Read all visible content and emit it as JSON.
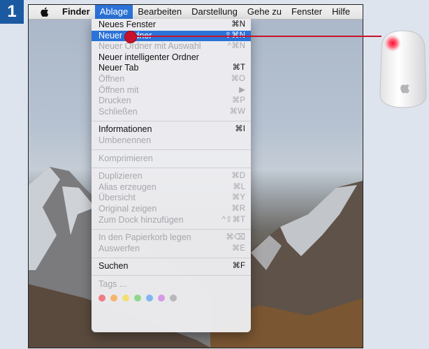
{
  "step_number": "1",
  "menubar": {
    "app_name": "Finder",
    "menus": [
      "Ablage",
      "Bearbeiten",
      "Darstellung",
      "Gehe zu",
      "Fenster",
      "Hilfe"
    ],
    "active_menu": "Ablage"
  },
  "file_menu": {
    "items": [
      {
        "label": "Neues Fenster",
        "shortcut": "⌘N",
        "enabled": true
      },
      {
        "label": "Neuer Ordner",
        "shortcut": "⇧⌘N",
        "enabled": true,
        "highlighted": true
      },
      {
        "label": "Neuer Ordner mit Auswahl",
        "shortcut": "^⌘N",
        "enabled": false
      },
      {
        "label": "Neuer intelligenter Ordner",
        "shortcut": "",
        "enabled": true
      },
      {
        "label": "Neuer Tab",
        "shortcut": "⌘T",
        "enabled": true
      },
      {
        "label": "Öffnen",
        "shortcut": "⌘O",
        "enabled": false
      },
      {
        "label": "Öffnen mit",
        "shortcut": "▶",
        "enabled": false
      },
      {
        "label": "Drucken",
        "shortcut": "⌘P",
        "enabled": false
      },
      {
        "label": "Schließen",
        "shortcut": "⌘W",
        "enabled": false
      },
      {
        "label": "Informationen",
        "shortcut": "⌘I",
        "enabled": true
      },
      {
        "label": "Umbenennen",
        "shortcut": "",
        "enabled": false
      },
      {
        "label": "Komprimieren",
        "shortcut": "",
        "enabled": false
      },
      {
        "label": "Duplizieren",
        "shortcut": "⌘D",
        "enabled": false
      },
      {
        "label": "Alias erzeugen",
        "shortcut": "⌘L",
        "enabled": false
      },
      {
        "label": "Übersicht",
        "shortcut": "⌘Y",
        "enabled": false
      },
      {
        "label": "Original zeigen",
        "shortcut": "⌘R",
        "enabled": false
      },
      {
        "label": "Zum Dock hinzufügen",
        "shortcut": "^⇧⌘T",
        "enabled": false
      },
      {
        "label": "In den Papierkorb legen",
        "shortcut": "⌘⌫",
        "enabled": false
      },
      {
        "label": "Auswerfen",
        "shortcut": "⌘E",
        "enabled": false
      },
      {
        "label": "Suchen",
        "shortcut": "⌘F",
        "enabled": true
      },
      {
        "label": "Tags ...",
        "shortcut": "",
        "enabled": false
      }
    ],
    "tag_colors": [
      "#f07b83",
      "#f6b46c",
      "#f2df71",
      "#8fd88a",
      "#7fb6f2",
      "#d69ae6",
      "#b8b8bc"
    ]
  },
  "colors": {
    "accent": "#2b73d8",
    "pointer": "#c9122a",
    "badge": "#1b5aa0"
  }
}
